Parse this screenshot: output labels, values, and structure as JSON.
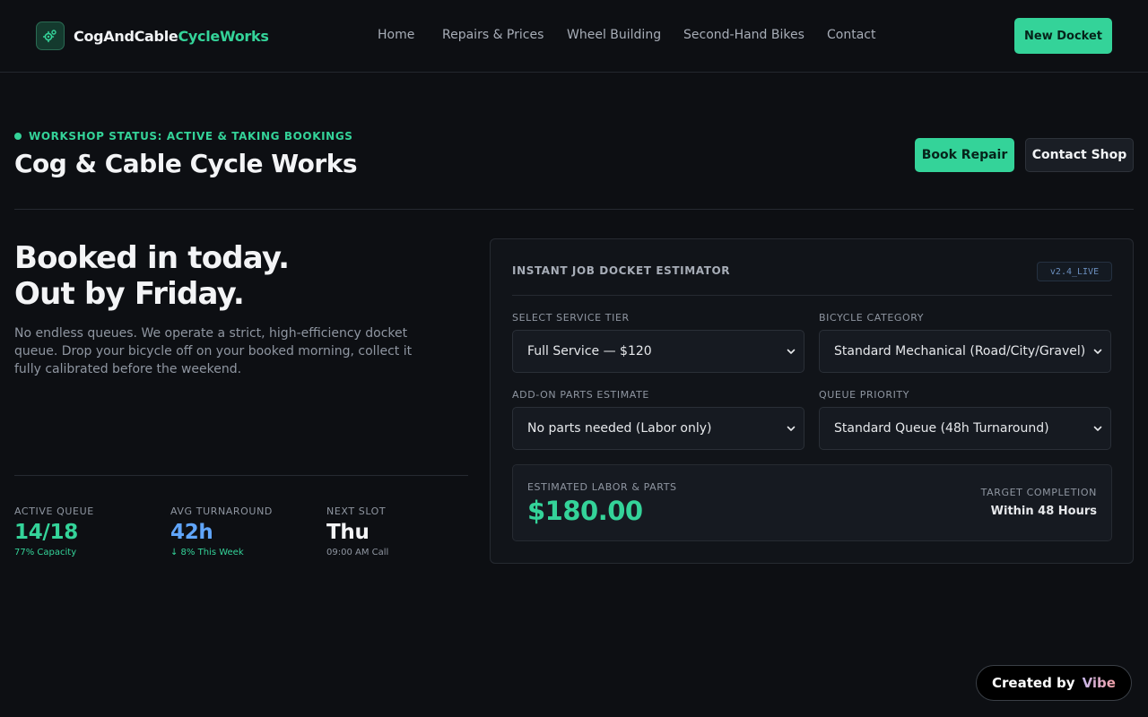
{
  "nav": {
    "brand_part1": "CogAndCable",
    "brand_part2": "CycleWorks",
    "links": [
      "Home",
      "Repairs & Prices",
      "Wheel Building",
      "Second-Hand Bikes",
      "Contact"
    ],
    "cta": "New Docket"
  },
  "header": {
    "status": "WORKSHOP STATUS: ACTIVE & TAKING BOOKINGS",
    "title": "Cog & Cable Cycle Works",
    "book_button": "Book Repair",
    "contact_button": "Contact Shop"
  },
  "hero": {
    "headline_line1": "Booked in today.",
    "headline_line2": "Out by Friday.",
    "subtext": "No endless queues. We operate a strict, high-efficiency docket queue. Drop your bicycle off on your booked morning, collect it fully calibrated before the weekend."
  },
  "stats": [
    {
      "label": "ACTIVE QUEUE",
      "value": "14/18",
      "note": "77% Capacity"
    },
    {
      "label": "AVG TURNAROUND",
      "value": "42h",
      "note": "↓ 8% This Week"
    },
    {
      "label": "NEXT SLOT",
      "value": "Thu",
      "note": "09:00 AM Call"
    }
  ],
  "estimator": {
    "title": "INSTANT JOB DOCKET ESTIMATOR",
    "version": "v2.4_LIVE",
    "fields": {
      "service_tier": {
        "label": "SELECT SERVICE TIER",
        "value": "Full Service — $120"
      },
      "bicycle_category": {
        "label": "BICYCLE CATEGORY",
        "value": "Standard Mechanical (Road/City/Gravel)"
      },
      "addon_parts": {
        "label": "ADD-ON PARTS ESTIMATE",
        "value": "No parts needed (Labor only)"
      },
      "queue_priority": {
        "label": "QUEUE PRIORITY",
        "value": "Standard Queue (48h Turnaround)"
      }
    },
    "result": {
      "label": "ESTIMATED LABOR & PARTS",
      "value": "$180.00",
      "completion_label": "TARGET COMPLETION",
      "completion_value": "Within 48 Hours"
    }
  },
  "footer_badge": {
    "prefix": "Created by",
    "name": "Vibe"
  },
  "colors": {
    "accent": "#34d399",
    "info": "#60a5fa",
    "background": "#0d0f13"
  }
}
